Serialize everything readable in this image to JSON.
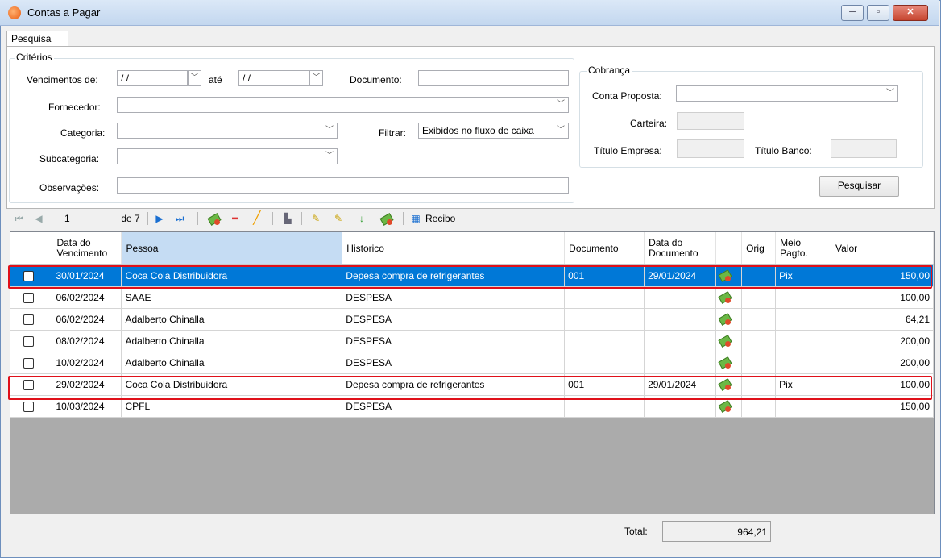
{
  "window": {
    "title": "Contas a Pagar",
    "min": "─",
    "max": "▫",
    "close": "✕"
  },
  "tab": {
    "label": "Pesquisa"
  },
  "criterios": {
    "label": "Critérios",
    "vencimentos_label": "Vencimentos de:",
    "venc_de": "/ /",
    "ate_label": "até",
    "venc_ate": "/ /",
    "documento_label": "Documento:",
    "documento_value": "",
    "fornecedor_label": "Fornecedor:",
    "fornecedor_value": "",
    "categoria_label": "Categoria:",
    "categoria_value": "",
    "filtrar_label": "Filtrar:",
    "filtrar_value": "Exibidos no fluxo de caixa",
    "subcategoria_label": "Subcategoria:",
    "subcategoria_value": "",
    "observacoes_label": "Observações:",
    "observacoes_value": ""
  },
  "cobranca": {
    "label": "Cobrança",
    "conta_proposta_label": "Conta Proposta:",
    "conta_proposta_value": "",
    "carteira_label": "Carteira:",
    "titulo_empresa_label": "Título Empresa:",
    "titulo_banco_label": "Título Banco:"
  },
  "pesquisar_button": "Pesquisar",
  "toolbar": {
    "first": "⏮",
    "prev": "◀",
    "page": "1",
    "of": "de 7",
    "next": "▶",
    "last": "⏭",
    "recibo": "Recibo"
  },
  "columns": [
    "",
    "Data do Vencimento",
    "Pessoa",
    "Historico",
    "Documento",
    "Data do Documento",
    "",
    "Orig",
    "Meio Pagto.",
    "Valor"
  ],
  "rows": [
    {
      "venc": "30/01/2024",
      "pessoa": "Coca Cola Distribuidora",
      "hist": "Depesa compra de refrigerantes",
      "doc": "001",
      "data_doc": "29/01/2024",
      "orig": "",
      "meio": "Pix",
      "valor": "150,00",
      "selected": true
    },
    {
      "venc": "06/02/2024",
      "pessoa": "SAAE",
      "hist": "DESPESA",
      "doc": "",
      "data_doc": "",
      "orig": "",
      "meio": "",
      "valor": "100,00"
    },
    {
      "venc": "06/02/2024",
      "pessoa": "Adalberto Chinalla",
      "hist": "DESPESA",
      "doc": "",
      "data_doc": "",
      "orig": "",
      "meio": "",
      "valor": "64,21"
    },
    {
      "venc": "08/02/2024",
      "pessoa": "Adalberto Chinalla",
      "hist": "DESPESA",
      "doc": "",
      "data_doc": "",
      "orig": "",
      "meio": "",
      "valor": "200,00"
    },
    {
      "venc": "10/02/2024",
      "pessoa": "Adalberto Chinalla",
      "hist": "DESPESA",
      "doc": "",
      "data_doc": "",
      "orig": "",
      "meio": "",
      "valor": "200,00"
    },
    {
      "venc": "29/02/2024",
      "pessoa": "Coca Cola Distribuidora",
      "hist": "Depesa compra de refrigerantes",
      "doc": "001",
      "data_doc": "29/01/2024",
      "orig": "",
      "meio": "Pix",
      "valor": "100,00"
    },
    {
      "venc": "10/03/2024",
      "pessoa": "CPFL",
      "hist": "DESPESA",
      "doc": "",
      "data_doc": "",
      "orig": "",
      "meio": "",
      "valor": "150,00"
    }
  ],
  "total": {
    "label": "Total:",
    "value": "964,21"
  },
  "colors": {
    "selection": "#0078d7",
    "highlight_box": "#e0101a",
    "grid_bg": "#ababab"
  }
}
